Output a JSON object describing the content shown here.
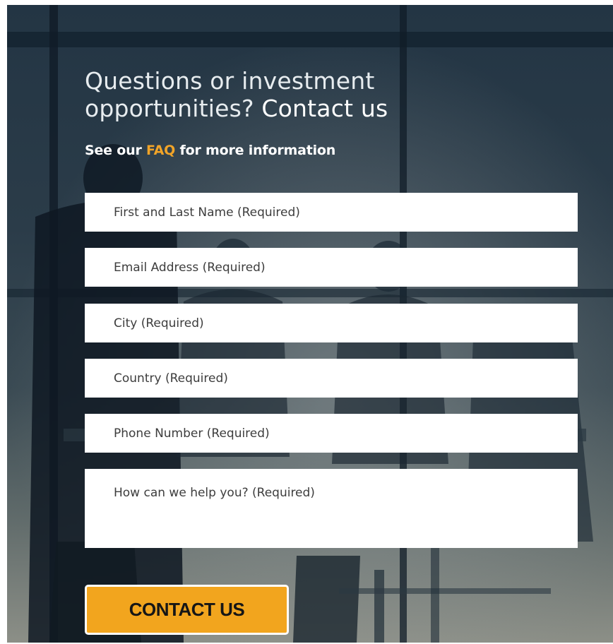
{
  "heading": {
    "line_light": "Questions or investment opportunities?",
    "line_strong": "Contact us"
  },
  "subheading": {
    "prefix": "See our",
    "link_text": "FAQ",
    "suffix": "for more information"
  },
  "form": {
    "name_placeholder": "First and Last Name (Required)",
    "email_placeholder": "Email Address (Required)",
    "city_placeholder": "City (Required)",
    "country_placeholder": "Country (Required)",
    "phone_placeholder": "Phone Number (Required)",
    "message_placeholder": "How can we help you? (Required)",
    "submit_label": "CONTACT US"
  },
  "colors": {
    "accent": "#f2a51e",
    "link": "#f1a428",
    "field_background": "#ffffff"
  }
}
